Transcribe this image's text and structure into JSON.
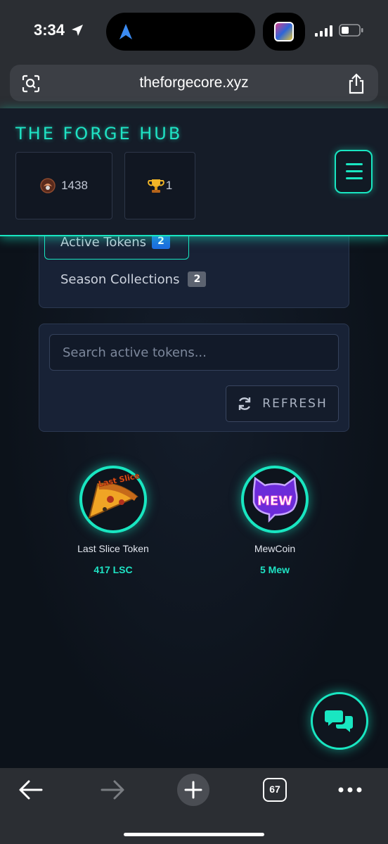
{
  "status_bar": {
    "time": "3:34",
    "icons": [
      "location-arrow-icon",
      "navigation-icon",
      "app-thumbnail",
      "signal-icon",
      "battery-icon"
    ]
  },
  "browser": {
    "url": "theforgecore.xyz",
    "icons": [
      "lens-icon",
      "share-icon"
    ],
    "tab_count": "67",
    "toolbar_icons": [
      "back-icon",
      "forward-icon",
      "new-tab-icon",
      "tabs-icon",
      "more-icon"
    ]
  },
  "header": {
    "brand": "THE FORGE HUB",
    "stats": [
      {
        "icon": "coin-icon",
        "value": "1438"
      },
      {
        "icon": "trophy-icon",
        "value": "1"
      }
    ],
    "menu_icon": "hamburger-menu-icon"
  },
  "tabs": [
    {
      "label": "Active Tokens",
      "count": "2",
      "active": true
    },
    {
      "label": "Season Collections",
      "count": "2",
      "active": false
    }
  ],
  "search": {
    "placeholder": "Search active tokens...",
    "refresh_label": "REFRESH"
  },
  "tokens": [
    {
      "name": "Last Slice Token",
      "balance": "417 LSC",
      "icon": "pizza-slice-icon",
      "icon_text": "Last Slice"
    },
    {
      "name": "MewCoin",
      "balance": "5 Mew",
      "icon": "mew-cat-icon",
      "icon_text": "MEW"
    }
  ],
  "colors": {
    "accent": "#19e6c1",
    "background": "#0c1118",
    "panel": "#182236",
    "badge_active": "#1d6de0",
    "badge_inactive": "#5c6370"
  }
}
